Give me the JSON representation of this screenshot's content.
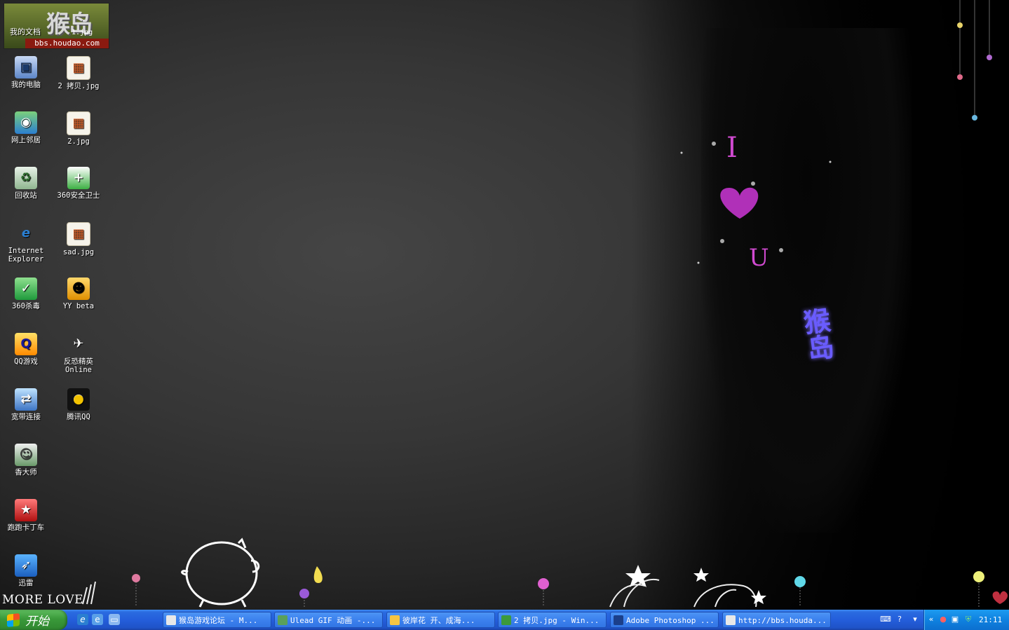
{
  "logo": {
    "title": "猴岛",
    "url": "bbs.houdao.com",
    "doc_label": "我的文档",
    "jpg_label": "1.jpg"
  },
  "desktop_icons": [
    {
      "label": "我的电脑",
      "icon": "computer-icon",
      "glyph": "▣"
    },
    {
      "label": "2 拷贝.jpg",
      "icon": "jpg-file-icon",
      "glyph": "▦"
    },
    {
      "label": "网上邻居",
      "icon": "network-icon",
      "glyph": "◉"
    },
    {
      "label": "2.jpg",
      "icon": "jpg-file-icon",
      "glyph": "▦"
    },
    {
      "label": "回收站",
      "icon": "recycle-bin-icon",
      "glyph": "♻"
    },
    {
      "label": "360安全卫士",
      "icon": "360-safeguard-icon",
      "glyph": "+"
    },
    {
      "label": "Internet\nExplorer",
      "icon": "ie-icon",
      "glyph": "e"
    },
    {
      "label": "sad.jpg",
      "icon": "jpg-file-icon",
      "glyph": "▦"
    },
    {
      "label": "360杀毒",
      "icon": "360-antivirus-icon",
      "glyph": "✓"
    },
    {
      "label": "YY beta",
      "icon": "yy-icon",
      "glyph": "☻"
    },
    {
      "label": "QQ游戏",
      "icon": "qq-game-icon",
      "glyph": "Q"
    },
    {
      "label": "反恐精英\nOnline",
      "icon": "counter-strike-icon",
      "glyph": "✈"
    },
    {
      "label": "宽带连接",
      "icon": "broadband-icon",
      "glyph": "⇄"
    },
    {
      "label": "腾讯QQ",
      "icon": "qq-penguin-icon",
      "glyph": "●"
    },
    {
      "label": "香大师",
      "icon": "xiang-master-icon",
      "glyph": "☺"
    },
    {
      "label": "跑跑卡丁车",
      "icon": "kart-rider-icon",
      "glyph": "★"
    },
    {
      "label": "迅雷",
      "icon": "thunder-icon",
      "glyph": "➶"
    }
  ],
  "wallpaper": {
    "letter_i": "I",
    "letter_u": "U",
    "houdao": "猴\n岛",
    "more_love": "MORE LOVE"
  },
  "taskbar": {
    "start_label": "开始",
    "quick_launch": [
      "ie-icon",
      "ie-alt-icon",
      "show-desktop-icon"
    ],
    "tasks": [
      {
        "label": "猴岛游戏论坛 - M...",
        "icon_color": "#e8e8e8"
      },
      {
        "label": "Ulead GIF 动画 -...",
        "icon_color": "#5aa05a"
      },
      {
        "label": "彼岸花 开、成海...",
        "icon_color": "#f5c542"
      },
      {
        "label": "2 拷贝.jpg - Win...",
        "icon_color": "#3c9a3c"
      },
      {
        "label": "Adobe Photoshop ...",
        "icon_color": "#1b3f8a"
      },
      {
        "label": "http://bbs.houda...",
        "icon_color": "#e8e8e8"
      }
    ],
    "clock": "21:11"
  },
  "colors": {
    "taskbar_blue": "#245edb",
    "start_green": "#3a9a3a",
    "tray_blue": "#0f82e0",
    "heart_magenta": "#b030b8",
    "houdao_purple": "#6a5cff"
  }
}
